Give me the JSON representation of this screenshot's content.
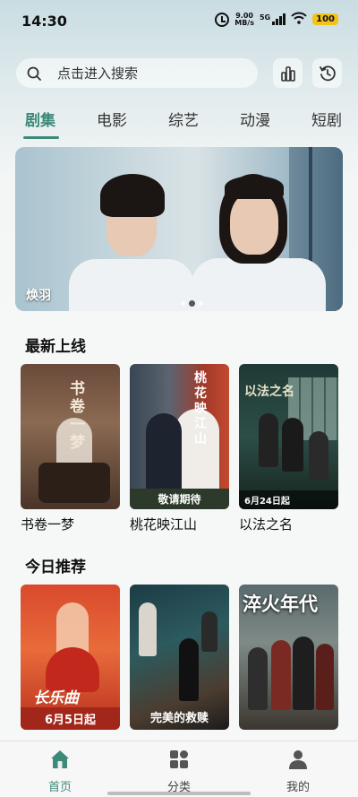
{
  "status_bar": {
    "time": "14:30",
    "speed_value": "9.00",
    "speed_unit": "MB/s",
    "network": "5G",
    "battery": "100",
    "battery_color": "#f3c21b"
  },
  "search": {
    "placeholder": "点击进入搜索",
    "icon": "search-icon"
  },
  "toolbar": {
    "chart_icon": "bar-chart-icon",
    "history_icon": "history-icon"
  },
  "tabs": [
    {
      "label": "剧集",
      "active": true
    },
    {
      "label": "电影",
      "active": false
    },
    {
      "label": "综艺",
      "active": false
    },
    {
      "label": "动漫",
      "active": false
    },
    {
      "label": "短剧",
      "active": false
    }
  ],
  "banner": {
    "title": "焕羽",
    "page_count": 3,
    "active_page": 2
  },
  "sections": {
    "latest": {
      "title": "最新上线",
      "items": [
        {
          "title": "书卷一梦",
          "poster_text": "书卷一梦"
        },
        {
          "title": "桃花映江山",
          "poster_text": "桃花映江山",
          "badge": "敬请期待"
        },
        {
          "title": "以法之名",
          "poster_text": "以法之名",
          "badge": "6月24日起"
        }
      ]
    },
    "recommend": {
      "title": "今日推荐",
      "items": [
        {
          "title": "……",
          "poster_text": "长乐曲",
          "badge": "6月5日起"
        },
        {
          "title": "……",
          "poster_text": "完美的救赎"
        },
        {
          "title": "……",
          "poster_text": "淬火年代"
        }
      ]
    }
  },
  "bottom_nav": [
    {
      "label": "首页",
      "icon": "home-icon",
      "active": true
    },
    {
      "label": "分类",
      "icon": "category-icon",
      "active": false
    },
    {
      "label": "我的",
      "icon": "profile-icon",
      "active": false
    }
  ],
  "colors": {
    "accent": "#3d8a7a",
    "text": "#111111"
  }
}
